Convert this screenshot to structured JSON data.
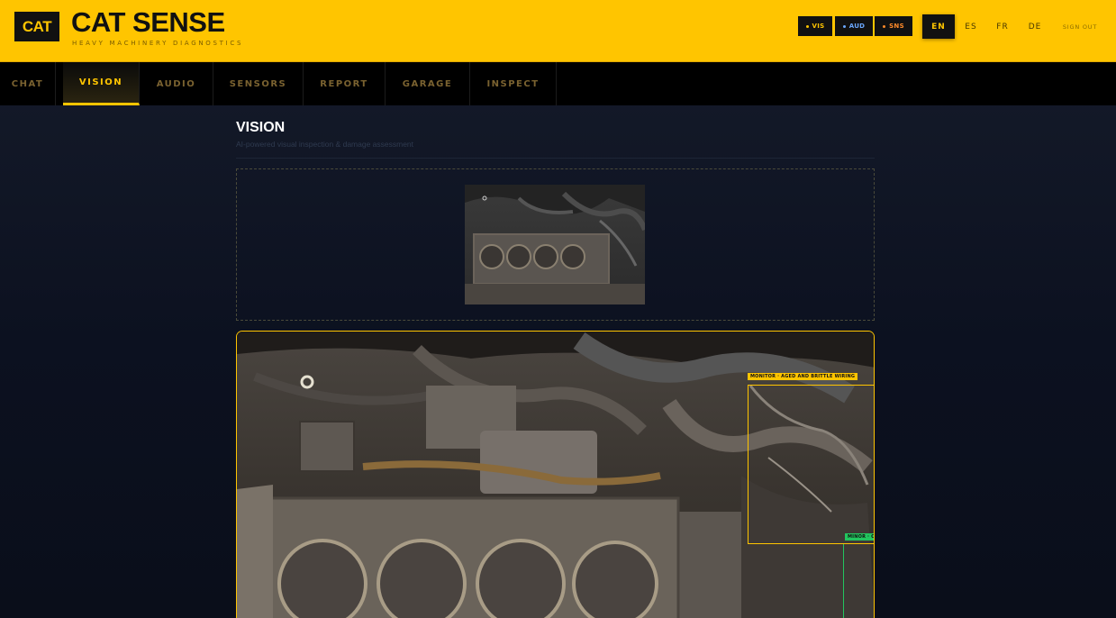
{
  "header": {
    "logo": "CAT",
    "title": "CAT SENSE",
    "subtitle": "HEAVY MACHINERY DIAGNOSTICS",
    "status_chips": [
      {
        "label": "VIS",
        "dot_color": "#ffc500"
      },
      {
        "label": "AUD",
        "dot_color": "#6aa8ff"
      },
      {
        "label": "SNS",
        "dot_color": "#ff8a2a"
      }
    ],
    "languages": [
      "EN",
      "ES",
      "FR",
      "DE"
    ],
    "active_language": "EN",
    "sign_out": "SIGN OUT"
  },
  "nav": {
    "tabs": [
      "CHAT",
      "VISION",
      "AUDIO",
      "SENSORS",
      "REPORT",
      "GARAGE",
      "INSPECT"
    ],
    "active": "VISION"
  },
  "main": {
    "title": "VISION",
    "subtitle": "AI-powered visual inspection & damage assessment"
  },
  "detections": [
    {
      "label": "MONITOR · AGED AND BRITTLE WIRING",
      "severity": "monitor",
      "color": "#ffc500"
    },
    {
      "label": "MINOR · C",
      "severity": "minor",
      "color": "#22c55e"
    }
  ],
  "colors": {
    "accent": "#ffc500",
    "background": "#0c1120",
    "minor": "#22c55e"
  }
}
